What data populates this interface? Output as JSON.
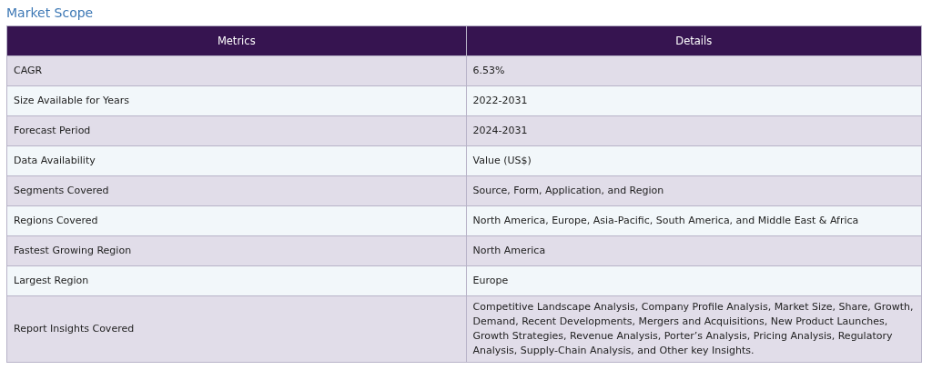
{
  "title": "Market Scope",
  "table": {
    "columns": [
      "Metrics",
      "Details"
    ],
    "rows": [
      [
        "CAGR",
        "6.53%"
      ],
      [
        "Size Available for Years",
        "2022-2031"
      ],
      [
        "Forecast Period",
        "2024-2031"
      ],
      [
        "Data Availability",
        "Value (US$)"
      ],
      [
        "Segments Covered",
        "Source, Form, Application, and Region"
      ],
      [
        "Regions Covered",
        "North America, Europe, Asia-Pacific, South America, and Middle East & Africa"
      ],
      [
        "Fastest Growing Region",
        "North America"
      ],
      [
        "Largest Region",
        "Europe"
      ],
      [
        "Report Insights Covered",
        "Competitive Landscape Analysis, Company Profile Analysis, Market Size, Share, Growth, Demand, Recent Developments, Mergers and Acquisitions, New Product Launches, Growth Strategies, Revenue Analysis, Porter’s Analysis, Pricing Analysis, Regulatory Analysis, Supply-Chain Analysis, and Other key Insights."
      ]
    ]
  }
}
